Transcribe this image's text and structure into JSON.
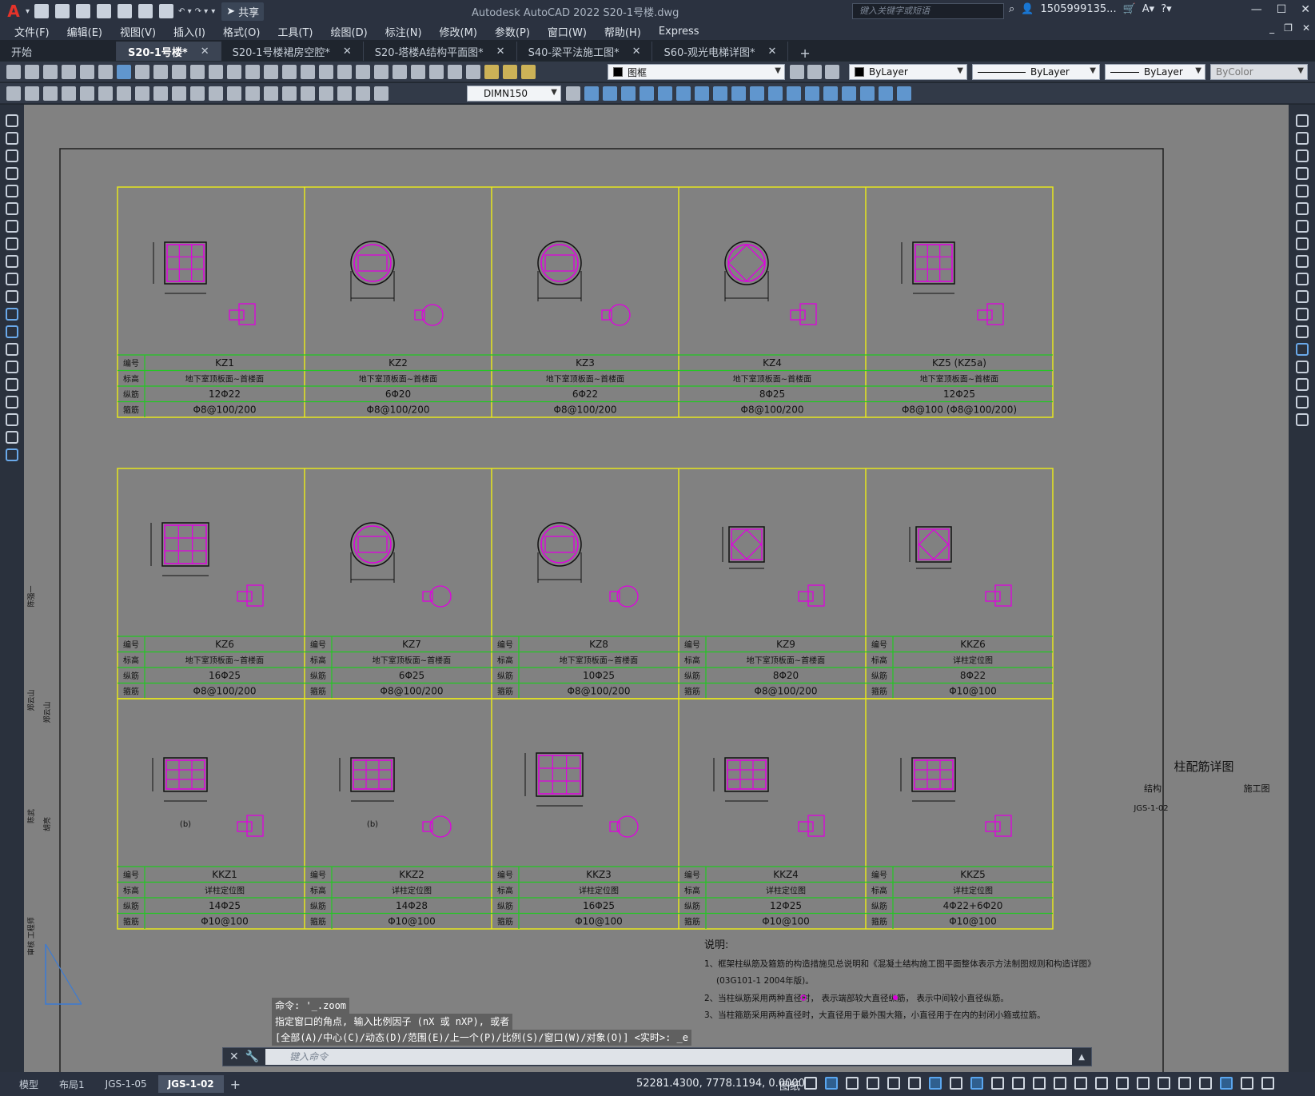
{
  "window": {
    "title": "Autodesk AutoCAD 2022    S20-1号楼.dwg",
    "search_placeholder": "键入关键字或短语",
    "user": "1505999135...",
    "share_label": "共享"
  },
  "menu": [
    "文件(F)",
    "编辑(E)",
    "视图(V)",
    "插入(I)",
    "格式(O)",
    "工具(T)",
    "绘图(D)",
    "标注(N)",
    "修改(M)",
    "参数(P)",
    "窗口(W)",
    "帮助(H)",
    "Express"
  ],
  "file_tabs": [
    {
      "label": "开始",
      "active": false,
      "closable": false
    },
    {
      "label": "S20-1号楼*",
      "active": true,
      "closable": true
    },
    {
      "label": "S20-1号楼裙房空腔*",
      "active": false,
      "closable": true
    },
    {
      "label": "S20-塔楼A结构平面图*",
      "active": false,
      "closable": true
    },
    {
      "label": "S40-梁平法施工图*",
      "active": false,
      "closable": true
    },
    {
      "label": "S60-观光电梯详图*",
      "active": false,
      "closable": true
    }
  ],
  "toolbar": {
    "layer": "图框",
    "color": "ByLayer",
    "linetype": "ByLayer",
    "lineweight": "ByLayer",
    "plotstyle": "ByColor",
    "dimstyle": "DIMN150"
  },
  "row_labels": {
    "id": "编号",
    "elev": "标高",
    "long": "纵筋",
    "stir": "箍筋"
  },
  "table_rows": [
    {
      "cells": [
        {
          "id": "KZ1",
          "elev": "地下室顶板面~首楼面",
          "long": "12Φ22",
          "stir": "Φ8@100/200"
        },
        {
          "id": "KZ2",
          "elev": "地下室顶板面~首楼面",
          "long": "6Φ20",
          "stir": "Φ8@100/200"
        },
        {
          "id": "KZ3",
          "elev": "地下室顶板面~首楼面",
          "long": "6Φ22",
          "stir": "Φ8@100/200"
        },
        {
          "id": "KZ4",
          "elev": "地下室顶板面~首楼面",
          "long": "8Φ25",
          "stir": "Φ8@100/200"
        },
        {
          "id": "KZ5 (KZ5a)",
          "elev": "地下室顶板面~首楼面",
          "long": "12Φ25",
          "stir": "Φ8@100   (Φ8@100/200)"
        }
      ]
    },
    {
      "cells": [
        {
          "id": "KZ6",
          "elev": "地下室顶板面~首楼面",
          "long": "16Φ25",
          "stir": "Φ8@100/200"
        },
        {
          "id": "KZ7",
          "elev": "地下室顶板面~首楼面",
          "long": "6Φ25",
          "stir": "Φ8@100/200"
        },
        {
          "id": "KZ8",
          "elev": "地下室顶板面~首楼面",
          "long": "10Φ25",
          "stir": "Φ8@100/200"
        },
        {
          "id": "KZ9",
          "elev": "地下室顶板面~首楼面",
          "long": "8Φ20",
          "stir": "Φ8@100/200"
        },
        {
          "id": "KKZ6",
          "elev": "详柱定位图",
          "long": "8Φ22",
          "stir": "Φ10@100"
        }
      ]
    },
    {
      "cells": [
        {
          "id": "KKZ1",
          "elev": "详柱定位图",
          "long": "14Φ25",
          "stir": "Φ10@100",
          "sub": "(b)"
        },
        {
          "id": "KKZ2",
          "elev": "详柱定位图",
          "long": "14Φ28",
          "stir": "Φ10@100",
          "sub": "(b)"
        },
        {
          "id": "KKZ3",
          "elev": "详柱定位图",
          "long": "16Φ25",
          "stir": "Φ10@100"
        },
        {
          "id": "KKZ4",
          "elev": "详柱定位图",
          "long": "12Φ25",
          "stir": "Φ10@100"
        },
        {
          "id": "KKZ5",
          "elev": "详柱定位图",
          "long": "4Φ22+6Φ20",
          "stir": "Φ10@100"
        }
      ]
    }
  ],
  "title_block": {
    "title": "柱配筋详图",
    "discipline": "结构",
    "stage": "施工图",
    "number": "JGS-1-02"
  },
  "notes": {
    "heading": "说明:",
    "lines": [
      "1、框架柱纵筋及箍筋的构造措施见总说明和《混凝土结构施工图平面整体表示方法制图规则和构造详图》",
      "(03G101-1 2004年版)。",
      "2、当柱纵筋采用两种直径时，   表示端部较大直径纵筋，   表示中间较小直径纵筋。",
      "3、当柱箍筋采用两种直径时，大直径用于最外围大箍，小直径用于在内的封闭小箍或拉筋。"
    ]
  },
  "side_texts": [
    "陈强一",
    "郑云山",
    "郑云山",
    "陈武",
    "胡亮",
    "审核 工程师"
  ],
  "command": {
    "history": [
      "命令: '_.zoom",
      "指定窗口的角点, 输入比例因子 (nX 或 nXP), 或者",
      "[全部(A)/中心(C)/动态(D)/范围(E)/上一个(P)/比例(S)/窗口(W)/对象(O)] <实时>: _e"
    ],
    "placeholder": "键入命令"
  },
  "layout_tabs": [
    {
      "label": "模型",
      "active": false
    },
    {
      "label": "布局1",
      "active": false
    },
    {
      "label": "JGS-1-05",
      "active": false
    },
    {
      "label": "JGS-1-02",
      "active": true
    }
  ],
  "status": {
    "coords": "52281.4300, 7778.1194, 0.0000",
    "space": "图纸"
  },
  "colors": {
    "canvas": "#818181",
    "grid_yellow": "#e6e61e",
    "grid_green": "#22c822",
    "rebar_magenta": "#e000e0",
    "accent_blue": "#5aa6ef"
  }
}
